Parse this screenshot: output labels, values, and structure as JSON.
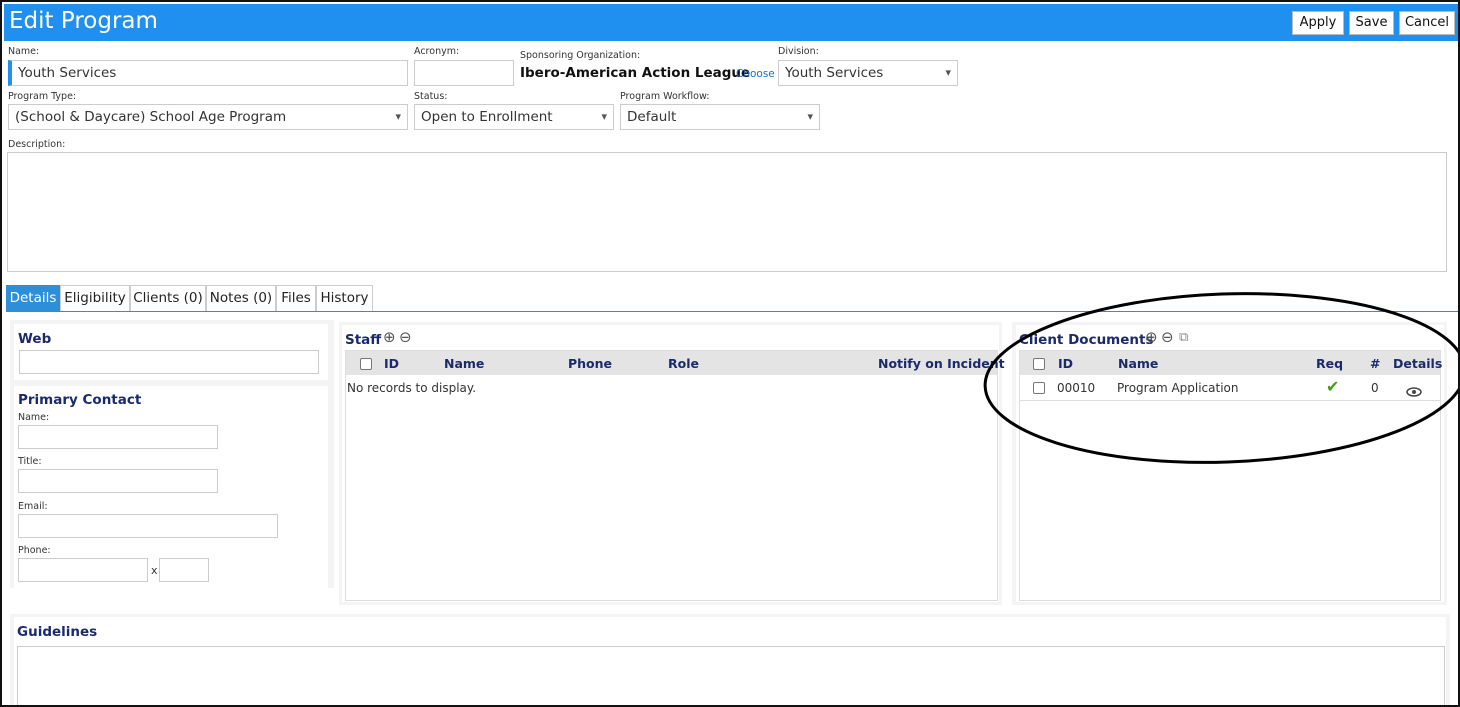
{
  "window": {
    "title": "Edit Program"
  },
  "toolbar": {
    "apply": "Apply",
    "save": "Save",
    "cancel": "Cancel"
  },
  "form": {
    "name_label": "Name:",
    "name_value": "Youth Services",
    "acronym_label": "Acronym:",
    "acronym_value": "",
    "sponsor_label": "Sponsoring Organization:",
    "sponsor_value": "Ibero-American Action League",
    "sponsor_link": "Choose",
    "division_label": "Division:",
    "division_value": "Youth Services",
    "program_type_label": "Program Type:",
    "program_type_value": "(School & Daycare) School Age Program",
    "status_label": "Status:",
    "status_value": "Open to Enrollment",
    "workflow_label": "Program Workflow:",
    "workflow_value": "Default",
    "description_label": "Description:"
  },
  "tabs": [
    {
      "label": "Details"
    },
    {
      "label": "Eligibility"
    },
    {
      "label": "Clients (0)"
    },
    {
      "label": "Notes (0)"
    },
    {
      "label": "Files"
    },
    {
      "label": "History"
    }
  ],
  "web": {
    "title": "Web"
  },
  "contact": {
    "title": "Primary Contact",
    "name_label": "Name:",
    "title_label": "Title:",
    "email_label": "Email:",
    "phone_label": "Phone:",
    "ext_label": "x"
  },
  "staff": {
    "title": "Staff",
    "columns": [
      "ID",
      "Name",
      "Phone",
      "Role",
      "Notify on Incident"
    ],
    "empty": "No records to display."
  },
  "documents": {
    "title": "Client Documents",
    "columns": [
      "ID",
      "Name",
      "Req",
      "#",
      "Details"
    ],
    "rows": [
      {
        "id": "00010",
        "name": "Program Application",
        "req": "✔",
        "count": "0"
      }
    ]
  },
  "guidelines": {
    "title": "Guidelines"
  },
  "colors": {
    "accent": "#2090f0",
    "heading": "#1a2a6c",
    "check": "#4a9a1a"
  },
  "icons": {
    "add": "plus-circle-icon",
    "remove": "minus-circle-icon",
    "copy": "copy-icon",
    "view": "eye-icon"
  }
}
